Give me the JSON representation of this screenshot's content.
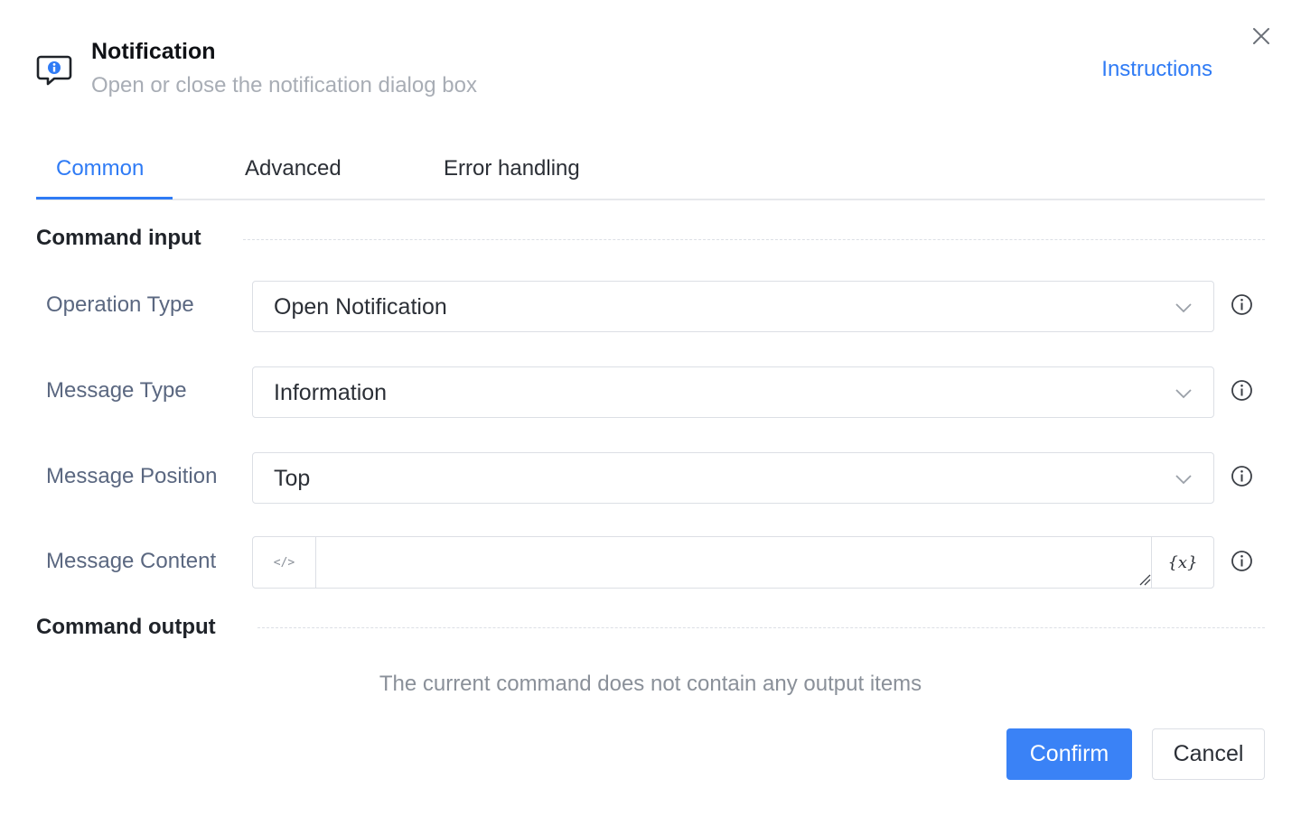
{
  "header": {
    "title": "Notification",
    "subtitle": "Open or close the notification dialog box",
    "instructions_link": "Instructions",
    "icon": "message-info-icon",
    "close_icon": "close-icon"
  },
  "tabs": [
    {
      "label": "Common",
      "active": true
    },
    {
      "label": "Advanced",
      "active": false
    },
    {
      "label": "Error handling",
      "active": false
    }
  ],
  "command_input": {
    "title": "Command input",
    "fields": [
      {
        "label": "Operation Type",
        "value": "Open Notification"
      },
      {
        "label": "Message Type",
        "value": "Information"
      },
      {
        "label": "Message Position",
        "value": "Top"
      },
      {
        "label": "Message Content",
        "value": "",
        "code_toggle": "</>",
        "variable_button": "{x}"
      }
    ]
  },
  "command_output": {
    "title": "Command output",
    "empty_text": "The current command does not contain any output items"
  },
  "footer": {
    "confirm_label": "Confirm",
    "cancel_label": "Cancel"
  },
  "colors": {
    "accent": "#2f7bf5",
    "confirm_bg": "#3a82f6",
    "label": "#5a6780",
    "muted": "#a8adb5"
  }
}
